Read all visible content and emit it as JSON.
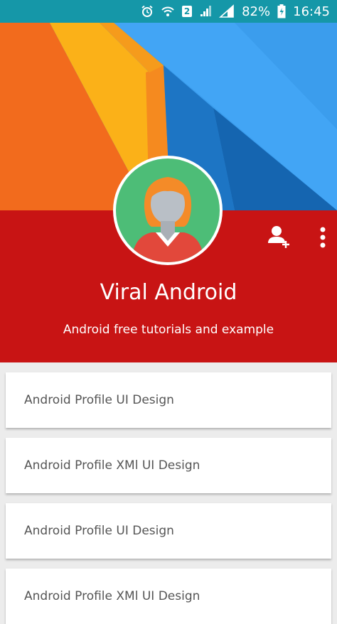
{
  "status_bar": {
    "battery_percent": "82%",
    "time": "16:45",
    "sim_label": "2",
    "icons": [
      "alarm-icon",
      "wifi-icon",
      "sim-2-icon",
      "signal-icon",
      "signal-full-icon",
      "battery-charging-icon"
    ]
  },
  "profile": {
    "name": "Viral Android",
    "subtitle": "Android free tutorials and example",
    "avatar_icon": "person-avatar-icon"
  },
  "actions": {
    "add_user_icon": "add-user-icon",
    "more_icon": "more-vertical-icon"
  },
  "list": {
    "items": [
      {
        "label": "Android Profile UI Design"
      },
      {
        "label": "Android Profile XMl UI Design"
      },
      {
        "label": "Android Profile UI Design"
      },
      {
        "label": "Android Profile XMl UI Design"
      }
    ]
  },
  "colors": {
    "status_bar": "#1597a8",
    "profile_panel": "#c81414",
    "avatar_bg": "#4dbd77",
    "banner_orange": "#f26b1d",
    "banner_yellow": "#fbb118",
    "banner_blue": "#1d8ad6",
    "banner_light_blue": "#42a5f5"
  }
}
